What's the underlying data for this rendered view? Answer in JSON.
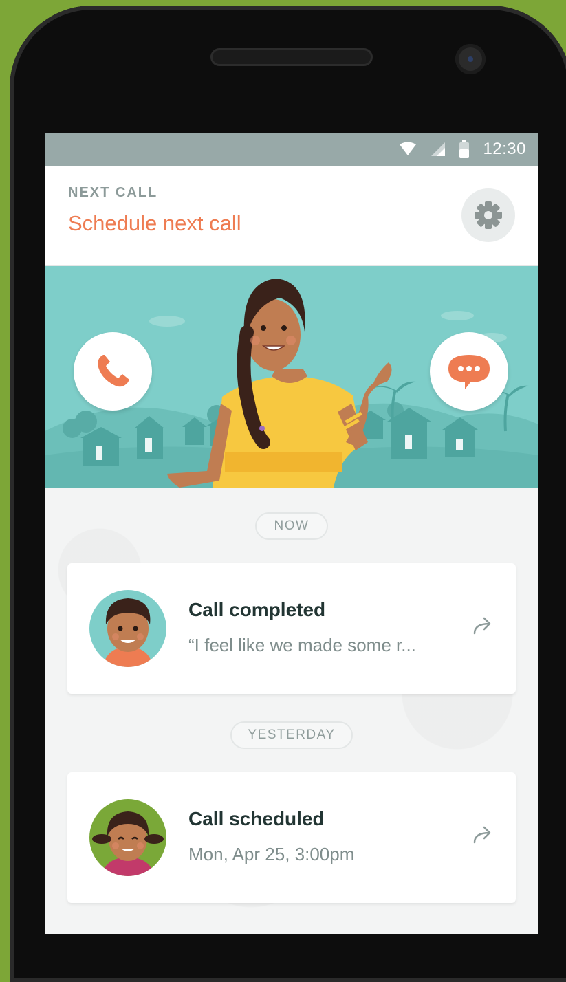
{
  "status_bar": {
    "time": "12:30",
    "icons": [
      "wifi-icon",
      "signal-icon",
      "battery-icon"
    ]
  },
  "header": {
    "label": "NEXT CALL",
    "action": "Schedule next call",
    "settings_icon": "gear-icon"
  },
  "hero": {
    "left_button_icon": "phone-icon",
    "right_button_icon": "chat-bubble-icon"
  },
  "feed": {
    "sections": [
      {
        "label": "NOW",
        "card": {
          "title": "Call completed",
          "subtitle": "“I feel like we made some r...",
          "avatar": "boy-avatar",
          "arrow_icon": "share-arrow-icon"
        }
      },
      {
        "label": "YESTERDAY",
        "card": {
          "title": "Call scheduled",
          "subtitle": "Mon, Apr 25, 3:00pm",
          "avatar": "girl-avatar",
          "arrow_icon": "share-arrow-icon"
        }
      }
    ]
  },
  "colors": {
    "background": "#7da637",
    "accent": "#ee7c52",
    "hero": "#7ecec9",
    "status_bar": "#98a9a8",
    "title_text": "#223533"
  }
}
